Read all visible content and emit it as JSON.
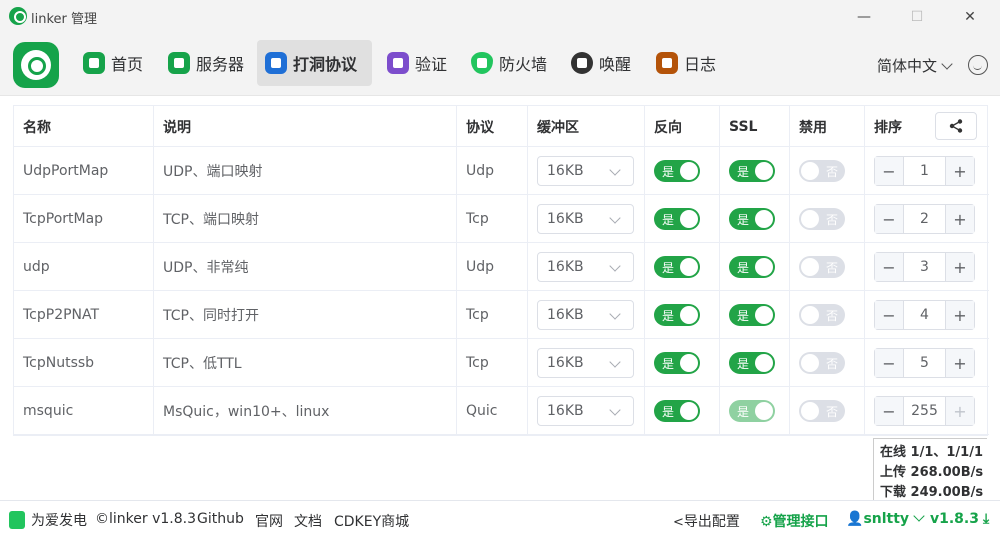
{
  "window": {
    "title": "linker 管理"
  },
  "nav": {
    "items": [
      {
        "label": "首页",
        "color": "#16a34a"
      },
      {
        "label": "服务器",
        "color": "#16a34a"
      },
      {
        "label": "打洞协议",
        "color": "#1f6fd6"
      },
      {
        "label": "验证",
        "color": "#7c4dcc"
      },
      {
        "label": "防火墙",
        "color": "#22c55e"
      },
      {
        "label": "唤醒",
        "color": "#333333"
      },
      {
        "label": "日志",
        "color": "#b45309"
      }
    ],
    "active_index": 2,
    "language": "简体中文"
  },
  "table": {
    "headers": [
      "名称",
      "说明",
      "协议",
      "缓冲区",
      "反向",
      "SSL",
      "禁用",
      "排序"
    ],
    "rows": [
      {
        "name": "UdpPortMap",
        "desc": "UDP、端口映射",
        "protocol": "Udp",
        "buffer": "16KB",
        "reverse": "是",
        "ssl": "是",
        "disabled": "否",
        "order": "1"
      },
      {
        "name": "TcpPortMap",
        "desc": "TCP、端口映射",
        "protocol": "Tcp",
        "buffer": "16KB",
        "reverse": "是",
        "ssl": "是",
        "disabled": "否",
        "order": "2"
      },
      {
        "name": "udp",
        "desc": "UDP、非常纯",
        "protocol": "Udp",
        "buffer": "16KB",
        "reverse": "是",
        "ssl": "是",
        "disabled": "否",
        "order": "3"
      },
      {
        "name": "TcpP2PNAT",
        "desc": "TCP、同时打开",
        "protocol": "Tcp",
        "buffer": "16KB",
        "reverse": "是",
        "ssl": "是",
        "disabled": "否",
        "order": "4"
      },
      {
        "name": "TcpNutssb",
        "desc": "TCP、低TTL",
        "protocol": "Tcp",
        "buffer": "16KB",
        "reverse": "是",
        "ssl": "是",
        "disabled": "否",
        "order": "5"
      },
      {
        "name": "msquic",
        "desc": "MsQuic，win10+、linux",
        "protocol": "Quic",
        "buffer": "16KB",
        "reverse": "是",
        "ssl": "是",
        "disabled": "否",
        "order": "255"
      }
    ]
  },
  "stats": {
    "online": "在线 1/1、1/1/1",
    "upload": "上传 268.00B/s",
    "download": "下载 249.00B/s"
  },
  "footer": {
    "charge": "为爱发电",
    "copyright": "©linker v1.8.3",
    "github": "Github",
    "website": "官网",
    "docs": "文档",
    "shop": "CDKEY商城",
    "export": "导出配置",
    "admin": "管理接口",
    "user": "snltty",
    "version": "v1.8.3"
  }
}
